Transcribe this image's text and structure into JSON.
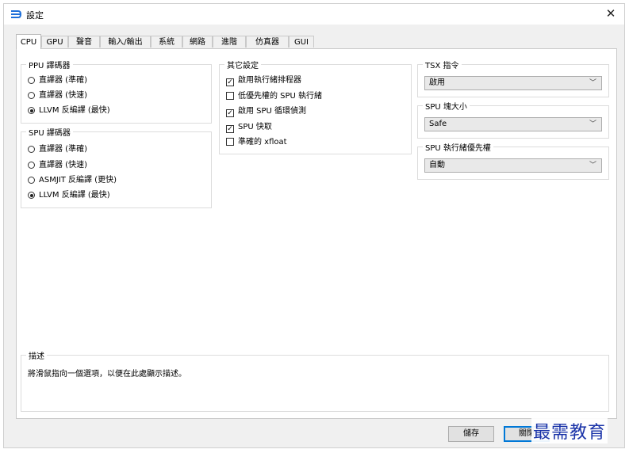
{
  "window": {
    "title": "設定",
    "close_symbol": "✕"
  },
  "tabs": [
    {
      "label": "CPU",
      "active": true
    },
    {
      "label": "GPU"
    },
    {
      "label": "聲音"
    },
    {
      "label": "輸入/輸出"
    },
    {
      "label": "系統"
    },
    {
      "label": "網路"
    },
    {
      "label": "進階"
    },
    {
      "label": "仿真器"
    },
    {
      "label": "GUI"
    }
  ],
  "ppu": {
    "title": "PPU 譯碼器",
    "options": [
      {
        "label": "直譯器 (準確)",
        "selected": false
      },
      {
        "label": "直譯器 (快速)",
        "selected": false
      },
      {
        "label": "LLVM 反編譯 (最快)",
        "selected": true
      }
    ]
  },
  "spu": {
    "title": "SPU 譯碼器",
    "options": [
      {
        "label": "直譯器 (準確)",
        "selected": false
      },
      {
        "label": "直譯器 (快速)",
        "selected": false
      },
      {
        "label": "ASMJIT 反編譯 (更快)",
        "selected": false
      },
      {
        "label": "LLVM 反編譯 (最快)",
        "selected": true
      }
    ]
  },
  "other": {
    "title": "其它設定",
    "options": [
      {
        "label": "啟用執行緒排程器",
        "checked": true
      },
      {
        "label": "低優先權的 SPU 執行緒",
        "checked": false
      },
      {
        "label": "啟用 SPU 循環偵測",
        "checked": true
      },
      {
        "label": "SPU 快取",
        "checked": true
      },
      {
        "label": "準確的 xfloat",
        "checked": false
      }
    ]
  },
  "tsx": {
    "title": "TSX 指令",
    "value": "啟用"
  },
  "spu_block": {
    "title": "SPU 塊大小",
    "value": "Safe"
  },
  "spu_priority": {
    "title": "SPU 執行緒優先權",
    "value": "自動"
  },
  "description": {
    "title": "描述",
    "text": "將滑鼠指向一個選項，以便在此處顯示描述。"
  },
  "buttons": {
    "save": "儲存",
    "close": "關閉"
  },
  "watermark": "最需教育",
  "colors": {
    "accent": "#0078d7",
    "watermark": "#1a33a8"
  },
  "icons": {
    "app": "app-icon",
    "dropdown": "chevron-down-icon"
  }
}
